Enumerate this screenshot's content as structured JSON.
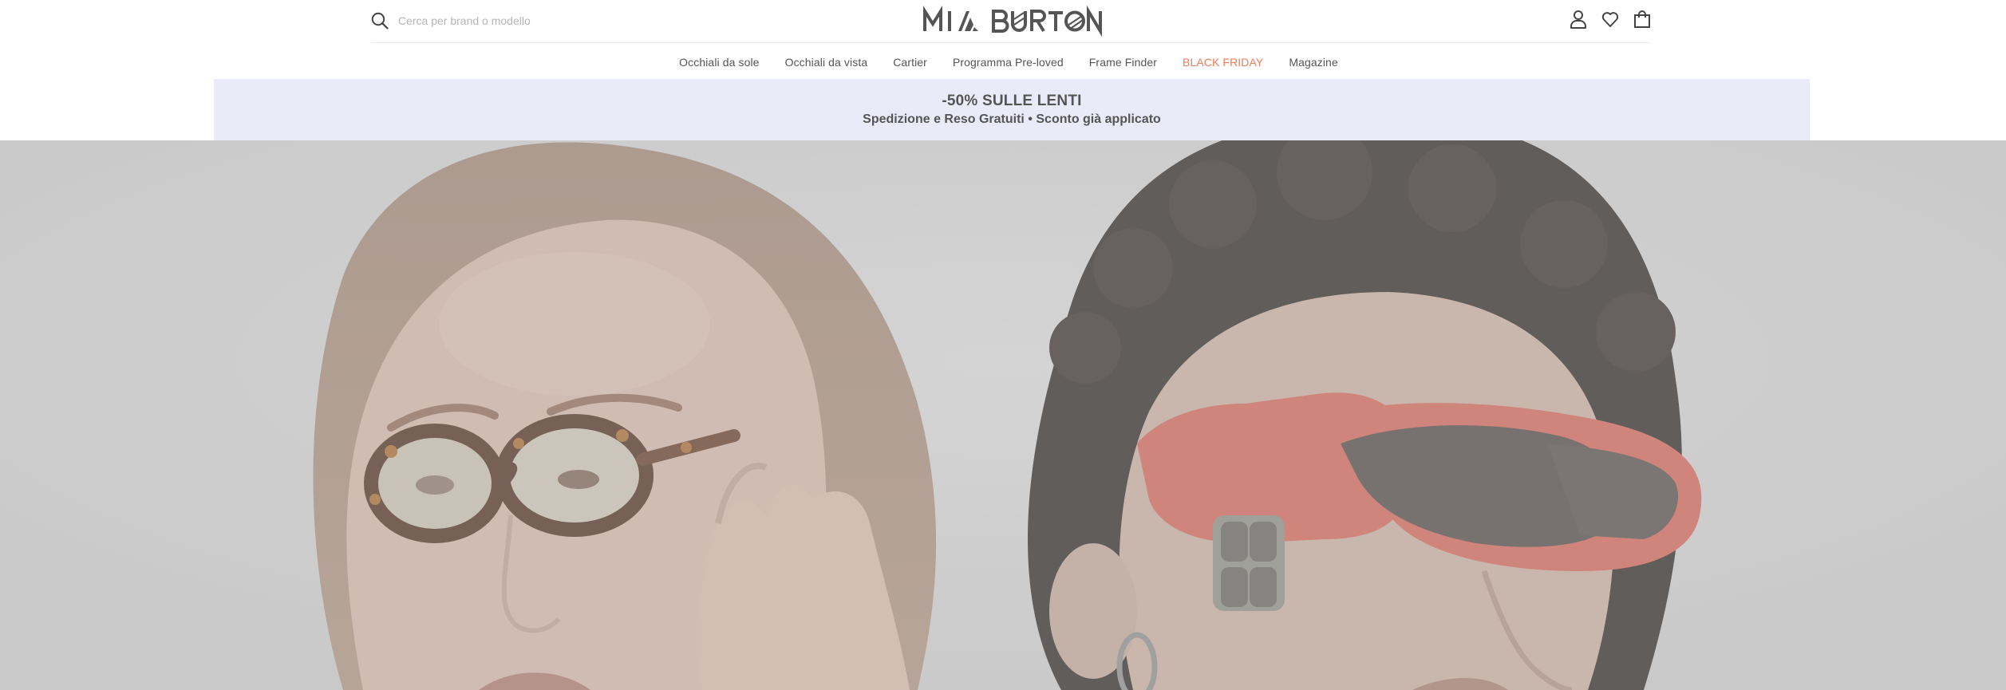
{
  "search": {
    "placeholder": "Cerca per brand o modello"
  },
  "logo": {
    "text": "MIA BURTON"
  },
  "header_icons": [
    "user-icon",
    "heart-icon",
    "shopping-bag-icon"
  ],
  "nav": {
    "items": [
      {
        "label": "Occhiali da sole"
      },
      {
        "label": "Occhiali da vista"
      },
      {
        "label": "Cartier"
      },
      {
        "label": "Programma Pre-loved"
      },
      {
        "label": "Frame Finder"
      },
      {
        "label": "BLACK FRIDAY"
      },
      {
        "label": "Magazine"
      }
    ]
  },
  "banner": {
    "headline": "-50% SULLE LENTI",
    "subline": "Spedizione e Reso Gratuiti • Sconto già applicato",
    "background": "#ebeaf8"
  },
  "colors": {
    "promo_link": "#f07a5a",
    "text": "#555555",
    "hero_overlay": "#c4c4c4"
  }
}
